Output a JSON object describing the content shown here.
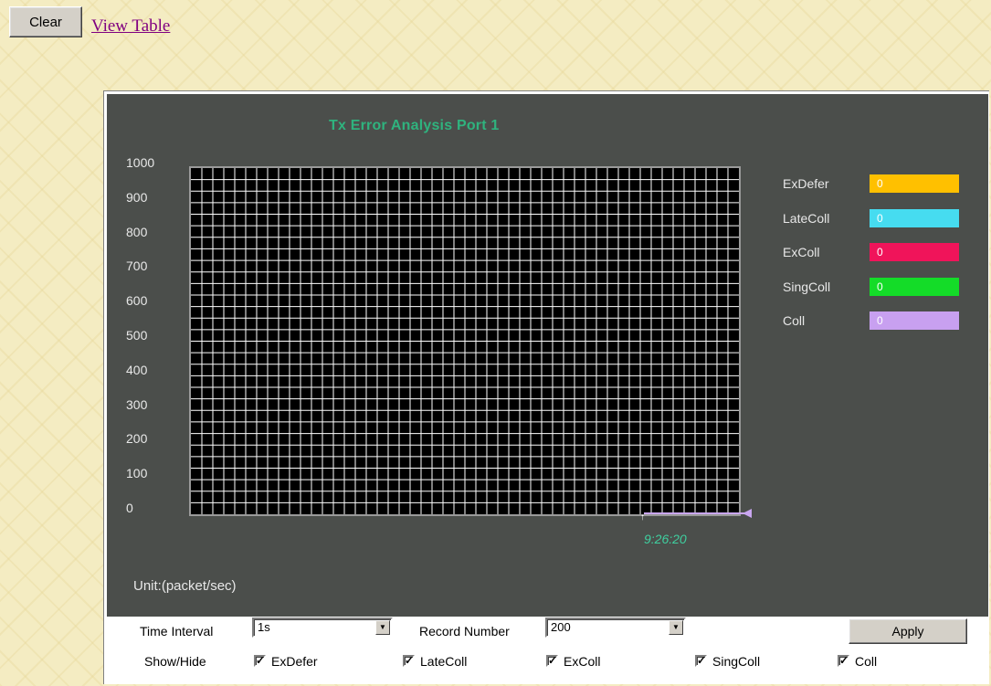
{
  "toolbar": {
    "clear_label": "Clear",
    "view_table_label": "View Table"
  },
  "chart": {
    "title": "Tx Error Analysis   Port 1",
    "unit_label": "Unit:(packet/sec)",
    "time_label": "9:26:20",
    "y_ticks": [
      "1000",
      "900",
      "800",
      "700",
      "600",
      "500",
      "400",
      "300",
      "200",
      "100",
      "0"
    ]
  },
  "legend": [
    {
      "label": "ExDefer",
      "value": "0",
      "color": "#ffc000"
    },
    {
      "label": "LateColl",
      "value": "0",
      "color": "#46dcf0"
    },
    {
      "label": "ExColl",
      "value": "0",
      "color": "#f0145a"
    },
    {
      "label": "SingColl",
      "value": "0",
      "color": "#14dc28"
    },
    {
      "label": "Coll",
      "value": "0",
      "color": "#c8a0f0"
    }
  ],
  "controls": {
    "time_interval_label": "Time Interval",
    "time_interval_value": "1s",
    "record_number_label": "Record Number",
    "record_number_value": "200",
    "apply_label": "Apply",
    "show_hide_label": "Show/Hide",
    "checkboxes": [
      {
        "label": "ExDefer",
        "checked": true
      },
      {
        "label": "LateColl",
        "checked": true
      },
      {
        "label": "ExColl",
        "checked": true
      },
      {
        "label": "SingColl",
        "checked": true
      },
      {
        "label": "Coll",
        "checked": true
      }
    ]
  },
  "chart_data": {
    "type": "line",
    "title": "Tx Error Analysis   Port 1",
    "ylabel": "Unit:(packet/sec)",
    "ylim": [
      0,
      1000
    ],
    "x": [
      "9:26:20"
    ],
    "series": [
      {
        "name": "ExDefer",
        "values": [
          0
        ]
      },
      {
        "name": "LateColl",
        "values": [
          0
        ]
      },
      {
        "name": "ExColl",
        "values": [
          0
        ]
      },
      {
        "name": "SingColl",
        "values": [
          0
        ]
      },
      {
        "name": "Coll",
        "values": [
          0
        ]
      }
    ],
    "grid": true,
    "legend": "right"
  }
}
